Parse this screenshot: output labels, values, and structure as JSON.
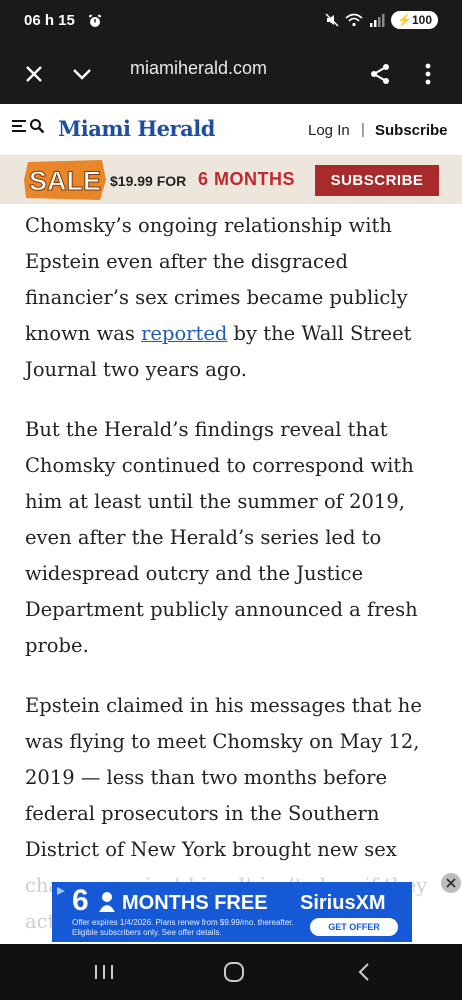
{
  "status": {
    "time": "06 h 15",
    "battery": "100"
  },
  "browser": {
    "url": "miamiherald.com"
  },
  "header": {
    "logo": "Miami Herald",
    "login": "Log In",
    "separator": "|",
    "subscribe": "Subscribe"
  },
  "promo": {
    "sale": "SALE",
    "price": "$19.99 FOR",
    "months": "6 MONTHS",
    "button": "SUBSCRIBE"
  },
  "article": {
    "p1_before": "Chomsky’s ongoing relationship with Epstein even after the disgraced financier’s sex crimes became publicly known was ",
    "p1_link": "reported",
    "p1_after": " by the Wall Street Journal two years ago.",
    "p2": "But the Herald’s findings reveal that Chomsky continued to correspond with him at least until the summer of 2019, even after the Herald’s series led to widespread outcry and the Justice Department publicly announced a fresh probe.",
    "p3": "Epstein claimed in his messages that he was flying to meet Chomsky on May 12, 2019 — less than two months before federal prosecutors in the Southern District of New York brought new sex charges against him. It isn’t clear if they actually met."
  },
  "ad": {
    "six": "6",
    "months_free": "MONTHS FREE",
    "brand": "SiriusXM",
    "fine_print": "Offer expires 1/4/2026. Plans renew from $9.99/mo. thereafter. Eligible subscribers only. See offer details.",
    "offer_button": "GET OFFER"
  }
}
